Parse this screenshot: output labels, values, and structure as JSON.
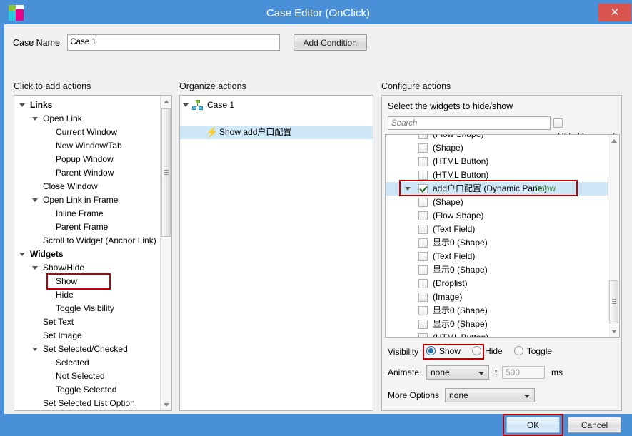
{
  "window": {
    "title": "Case Editor (OnClick)",
    "close_label": "✕",
    "icon_name": "app-logo-icon",
    "titlebar_color": "#4a90d9",
    "close_color": "#d9534f"
  },
  "form": {
    "case_name_label": "Case Name",
    "case_name_value": "Case 1",
    "add_condition_label": "Add Condition"
  },
  "sections": {
    "left_title": "Click to add actions",
    "mid_title": "Organize actions",
    "right_title": "Configure actions"
  },
  "actions_tree": [
    {
      "label": "Links",
      "indent": 0,
      "arrow": "open",
      "bold": true
    },
    {
      "label": "Open Link",
      "indent": 1,
      "arrow": "open",
      "bold": false
    },
    {
      "label": "Current Window",
      "indent": 2,
      "arrow": "",
      "bold": false
    },
    {
      "label": "New Window/Tab",
      "indent": 2,
      "arrow": "",
      "bold": false
    },
    {
      "label": "Popup Window",
      "indent": 2,
      "arrow": "",
      "bold": false
    },
    {
      "label": "Parent Window",
      "indent": 2,
      "arrow": "",
      "bold": false
    },
    {
      "label": "Close Window",
      "indent": 1,
      "arrow": "",
      "bold": false
    },
    {
      "label": "Open Link in Frame",
      "indent": 1,
      "arrow": "open",
      "bold": false
    },
    {
      "label": "Inline Frame",
      "indent": 2,
      "arrow": "",
      "bold": false
    },
    {
      "label": "Parent Frame",
      "indent": 2,
      "arrow": "",
      "bold": false
    },
    {
      "label": "Scroll to Widget (Anchor Link)",
      "indent": 1,
      "arrow": "",
      "bold": false
    },
    {
      "label": "Widgets",
      "indent": 0,
      "arrow": "open",
      "bold": true
    },
    {
      "label": "Show/Hide",
      "indent": 1,
      "arrow": "open",
      "bold": false
    },
    {
      "label": "Show",
      "indent": 2,
      "arrow": "",
      "bold": false,
      "highlight": true
    },
    {
      "label": "Hide",
      "indent": 2,
      "arrow": "",
      "bold": false
    },
    {
      "label": "Toggle Visibility",
      "indent": 2,
      "arrow": "",
      "bold": false
    },
    {
      "label": "Set Text",
      "indent": 1,
      "arrow": "",
      "bold": false
    },
    {
      "label": "Set Image",
      "indent": 1,
      "arrow": "",
      "bold": false
    },
    {
      "label": "Set Selected/Checked",
      "indent": 1,
      "arrow": "open",
      "bold": false
    },
    {
      "label": "Selected",
      "indent": 2,
      "arrow": "",
      "bold": false
    },
    {
      "label": "Not Selected",
      "indent": 2,
      "arrow": "",
      "bold": false
    },
    {
      "label": "Toggle Selected",
      "indent": 2,
      "arrow": "",
      "bold": false
    },
    {
      "label": "Set Selected List Option",
      "indent": 1,
      "arrow": "",
      "bold": false
    }
  ],
  "organize": {
    "case_label": "Case 1",
    "action_label": "Show add户口配置"
  },
  "configure": {
    "instruction": "Select the widgets to hide/show",
    "search_placeholder": "Search",
    "hide_unnamed_label": "Hide Unnamed",
    "hide_unnamed_checked": false,
    "widgets": [
      {
        "text": "(Flow Shape)",
        "checked": false,
        "clipped_top": true
      },
      {
        "text": "(Shape)",
        "checked": false
      },
      {
        "text": "(HTML Button)",
        "checked": false
      },
      {
        "text": "(HTML Button)",
        "checked": false
      },
      {
        "text": "add户口配置 (Dynamic Panel)",
        "suffix": "Show",
        "checked": true,
        "selected": true,
        "expandable": true,
        "highlight": true
      },
      {
        "text": "(Shape)",
        "checked": false
      },
      {
        "text": "(Flow Shape)",
        "checked": false
      },
      {
        "text": "(Text Field)",
        "checked": false
      },
      {
        "text": "显示0 (Shape)",
        "checked": false
      },
      {
        "text": "(Text Field)",
        "checked": false
      },
      {
        "text": "显示0 (Shape)",
        "checked": false
      },
      {
        "text": "(Droplist)",
        "checked": false
      },
      {
        "text": "(Image)",
        "checked": false
      },
      {
        "text": "显示0 (Shape)",
        "checked": false
      },
      {
        "text": "显示0 (Shape)",
        "checked": false
      },
      {
        "text": "(HTML Button)",
        "checked": false,
        "clipped_bottom": true
      }
    ],
    "visibility_label": "Visibility",
    "visibility_options": [
      {
        "label": "Show",
        "selected": true,
        "highlight": true
      },
      {
        "label": "Hide",
        "selected": false
      },
      {
        "label": "Toggle",
        "selected": false
      }
    ],
    "animate_label": "Animate",
    "animate_value": "none",
    "time_label": "t",
    "time_value": "500",
    "ms_label": "ms",
    "more_options_label": "More Options",
    "more_options_value": "none"
  },
  "footer": {
    "ok_label": "OK",
    "cancel_label": "Cancel"
  },
  "accent": {
    "highlight_border": "#c00000",
    "selection_bg": "#cfe8f7",
    "green_text": "#3a8a3a"
  }
}
